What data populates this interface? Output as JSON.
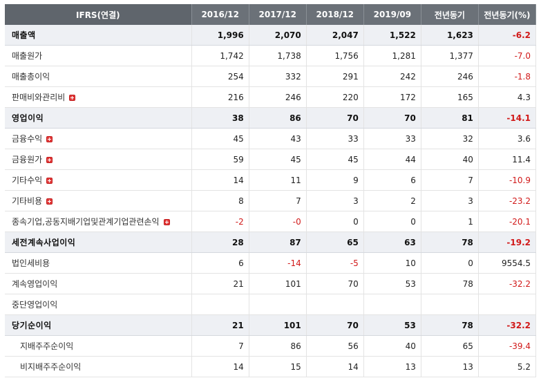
{
  "colors": {
    "header_bg": "#6b7178",
    "negative": "#d11919",
    "major_row_bg": "#eef0f4",
    "expand_icon": "#e23b3b"
  },
  "header": [
    "IFRS(연결)",
    "2016/12",
    "2017/12",
    "2018/12",
    "2019/09",
    "전년동기",
    "전년동기(%)"
  ],
  "rows": [
    {
      "label": "매출액",
      "values": [
        "1,996",
        "2,070",
        "2,047",
        "1,522",
        "1,623",
        "-6.2"
      ],
      "major": true,
      "expand": false,
      "sub": false
    },
    {
      "label": "매출원가",
      "values": [
        "1,742",
        "1,738",
        "1,756",
        "1,281",
        "1,377",
        "-7.0"
      ],
      "major": false,
      "expand": false,
      "sub": false
    },
    {
      "label": "매출총이익",
      "values": [
        "254",
        "332",
        "291",
        "242",
        "246",
        "-1.8"
      ],
      "major": false,
      "expand": false,
      "sub": false
    },
    {
      "label": "판매비와관리비",
      "values": [
        "216",
        "246",
        "220",
        "172",
        "165",
        "4.3"
      ],
      "major": false,
      "expand": true,
      "sub": false
    },
    {
      "label": "영업이익",
      "values": [
        "38",
        "86",
        "70",
        "70",
        "81",
        "-14.1"
      ],
      "major": true,
      "expand": false,
      "sub": false
    },
    {
      "label": "금융수익",
      "values": [
        "45",
        "43",
        "33",
        "33",
        "32",
        "3.6"
      ],
      "major": false,
      "expand": true,
      "sub": false
    },
    {
      "label": "금융원가",
      "values": [
        "59",
        "45",
        "45",
        "44",
        "40",
        "11.4"
      ],
      "major": false,
      "expand": true,
      "sub": false
    },
    {
      "label": "기타수익",
      "values": [
        "14",
        "11",
        "9",
        "6",
        "7",
        "-10.9"
      ],
      "major": false,
      "expand": true,
      "sub": false
    },
    {
      "label": "기타비용",
      "values": [
        "8",
        "7",
        "3",
        "2",
        "3",
        "-23.2"
      ],
      "major": false,
      "expand": true,
      "sub": false
    },
    {
      "label": "종속기업,공동지배기업및관계기업관련손익",
      "values": [
        "-2",
        "-0",
        "0",
        "0",
        "1",
        "-20.1"
      ],
      "major": false,
      "expand": true,
      "sub": false
    },
    {
      "label": "세전계속사업이익",
      "values": [
        "28",
        "87",
        "65",
        "63",
        "78",
        "-19.2"
      ],
      "major": true,
      "expand": false,
      "sub": false
    },
    {
      "label": "법인세비용",
      "values": [
        "6",
        "-14",
        "-5",
        "10",
        "0",
        "9554.5"
      ],
      "major": false,
      "expand": false,
      "sub": false
    },
    {
      "label": "계속영업이익",
      "values": [
        "21",
        "101",
        "70",
        "53",
        "78",
        "-32.2"
      ],
      "major": false,
      "expand": false,
      "sub": false
    },
    {
      "label": "중단영업이익",
      "values": [
        "",
        "",
        "",
        "",
        "",
        ""
      ],
      "major": false,
      "expand": false,
      "sub": false
    },
    {
      "label": "당기순이익",
      "values": [
        "21",
        "101",
        "70",
        "53",
        "78",
        "-32.2"
      ],
      "major": true,
      "expand": false,
      "sub": false
    },
    {
      "label": "지배주주순이익",
      "values": [
        "7",
        "86",
        "56",
        "40",
        "65",
        "-39.4"
      ],
      "major": false,
      "expand": false,
      "sub": true
    },
    {
      "label": "비지배주주순이익",
      "values": [
        "14",
        "15",
        "14",
        "13",
        "13",
        "5.2"
      ],
      "major": false,
      "expand": false,
      "sub": true
    }
  ]
}
